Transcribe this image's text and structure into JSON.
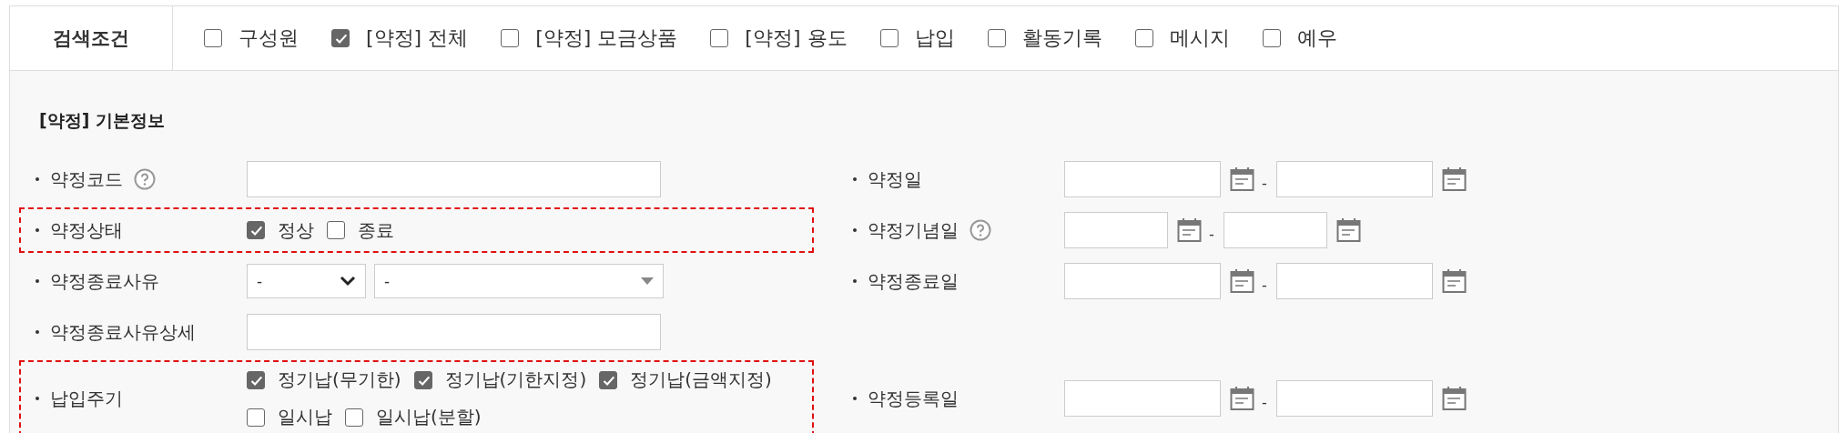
{
  "search_conditions": {
    "label": "검색조건",
    "options": [
      {
        "label": "구성원",
        "checked": false
      },
      {
        "label": "[약정] 전체",
        "checked": true
      },
      {
        "label": "[약정] 모금상품",
        "checked": false
      },
      {
        "label": "[약정] 용도",
        "checked": false
      },
      {
        "label": "납입",
        "checked": false
      },
      {
        "label": "활동기록",
        "checked": false
      },
      {
        "label": "메시지",
        "checked": false
      },
      {
        "label": "예우",
        "checked": false
      }
    ]
  },
  "section": {
    "title": "[약정] 기본정보",
    "rows": [
      {
        "left": {
          "label": "약정코드",
          "help": true,
          "highlighted": false,
          "kind": "text"
        },
        "right": {
          "label": "약정일",
          "help": false,
          "kind": "date_range",
          "separator": "-"
        }
      },
      {
        "left": {
          "label": "약정상태",
          "help": false,
          "highlighted": true,
          "kind": "checks",
          "lines": [
            [
              {
                "label": "정상",
                "checked": true
              },
              {
                "label": "종료",
                "checked": false
              }
            ]
          ]
        },
        "right": {
          "label": "약정기념일",
          "help": true,
          "kind": "short_date_range",
          "separator": "-"
        }
      },
      {
        "left": {
          "label": "약정종료사유",
          "help": false,
          "highlighted": false,
          "kind": "selects",
          "selects": [
            {
              "value": "-"
            },
            {
              "value": "-"
            }
          ]
        },
        "right": {
          "label": "약정종료일",
          "help": false,
          "kind": "date_range",
          "separator": "-"
        }
      },
      {
        "left": {
          "label": "약정종료사유상세",
          "help": false,
          "highlighted": false,
          "kind": "text"
        }
      },
      {
        "left": {
          "label": "납입주기",
          "help": false,
          "highlighted": true,
          "kind": "checks",
          "lines": [
            [
              {
                "label": "정기납(무기한)",
                "checked": true
              },
              {
                "label": "정기납(기한지정)",
                "checked": true
              },
              {
                "label": "정기납(금액지정)",
                "checked": true
              }
            ],
            [
              {
                "label": "일시납",
                "checked": false
              },
              {
                "label": "일시납(분할)",
                "checked": false
              }
            ]
          ]
        },
        "right": {
          "label": "약정등록일",
          "help": false,
          "kind": "date_range",
          "separator": "-"
        }
      }
    ]
  }
}
